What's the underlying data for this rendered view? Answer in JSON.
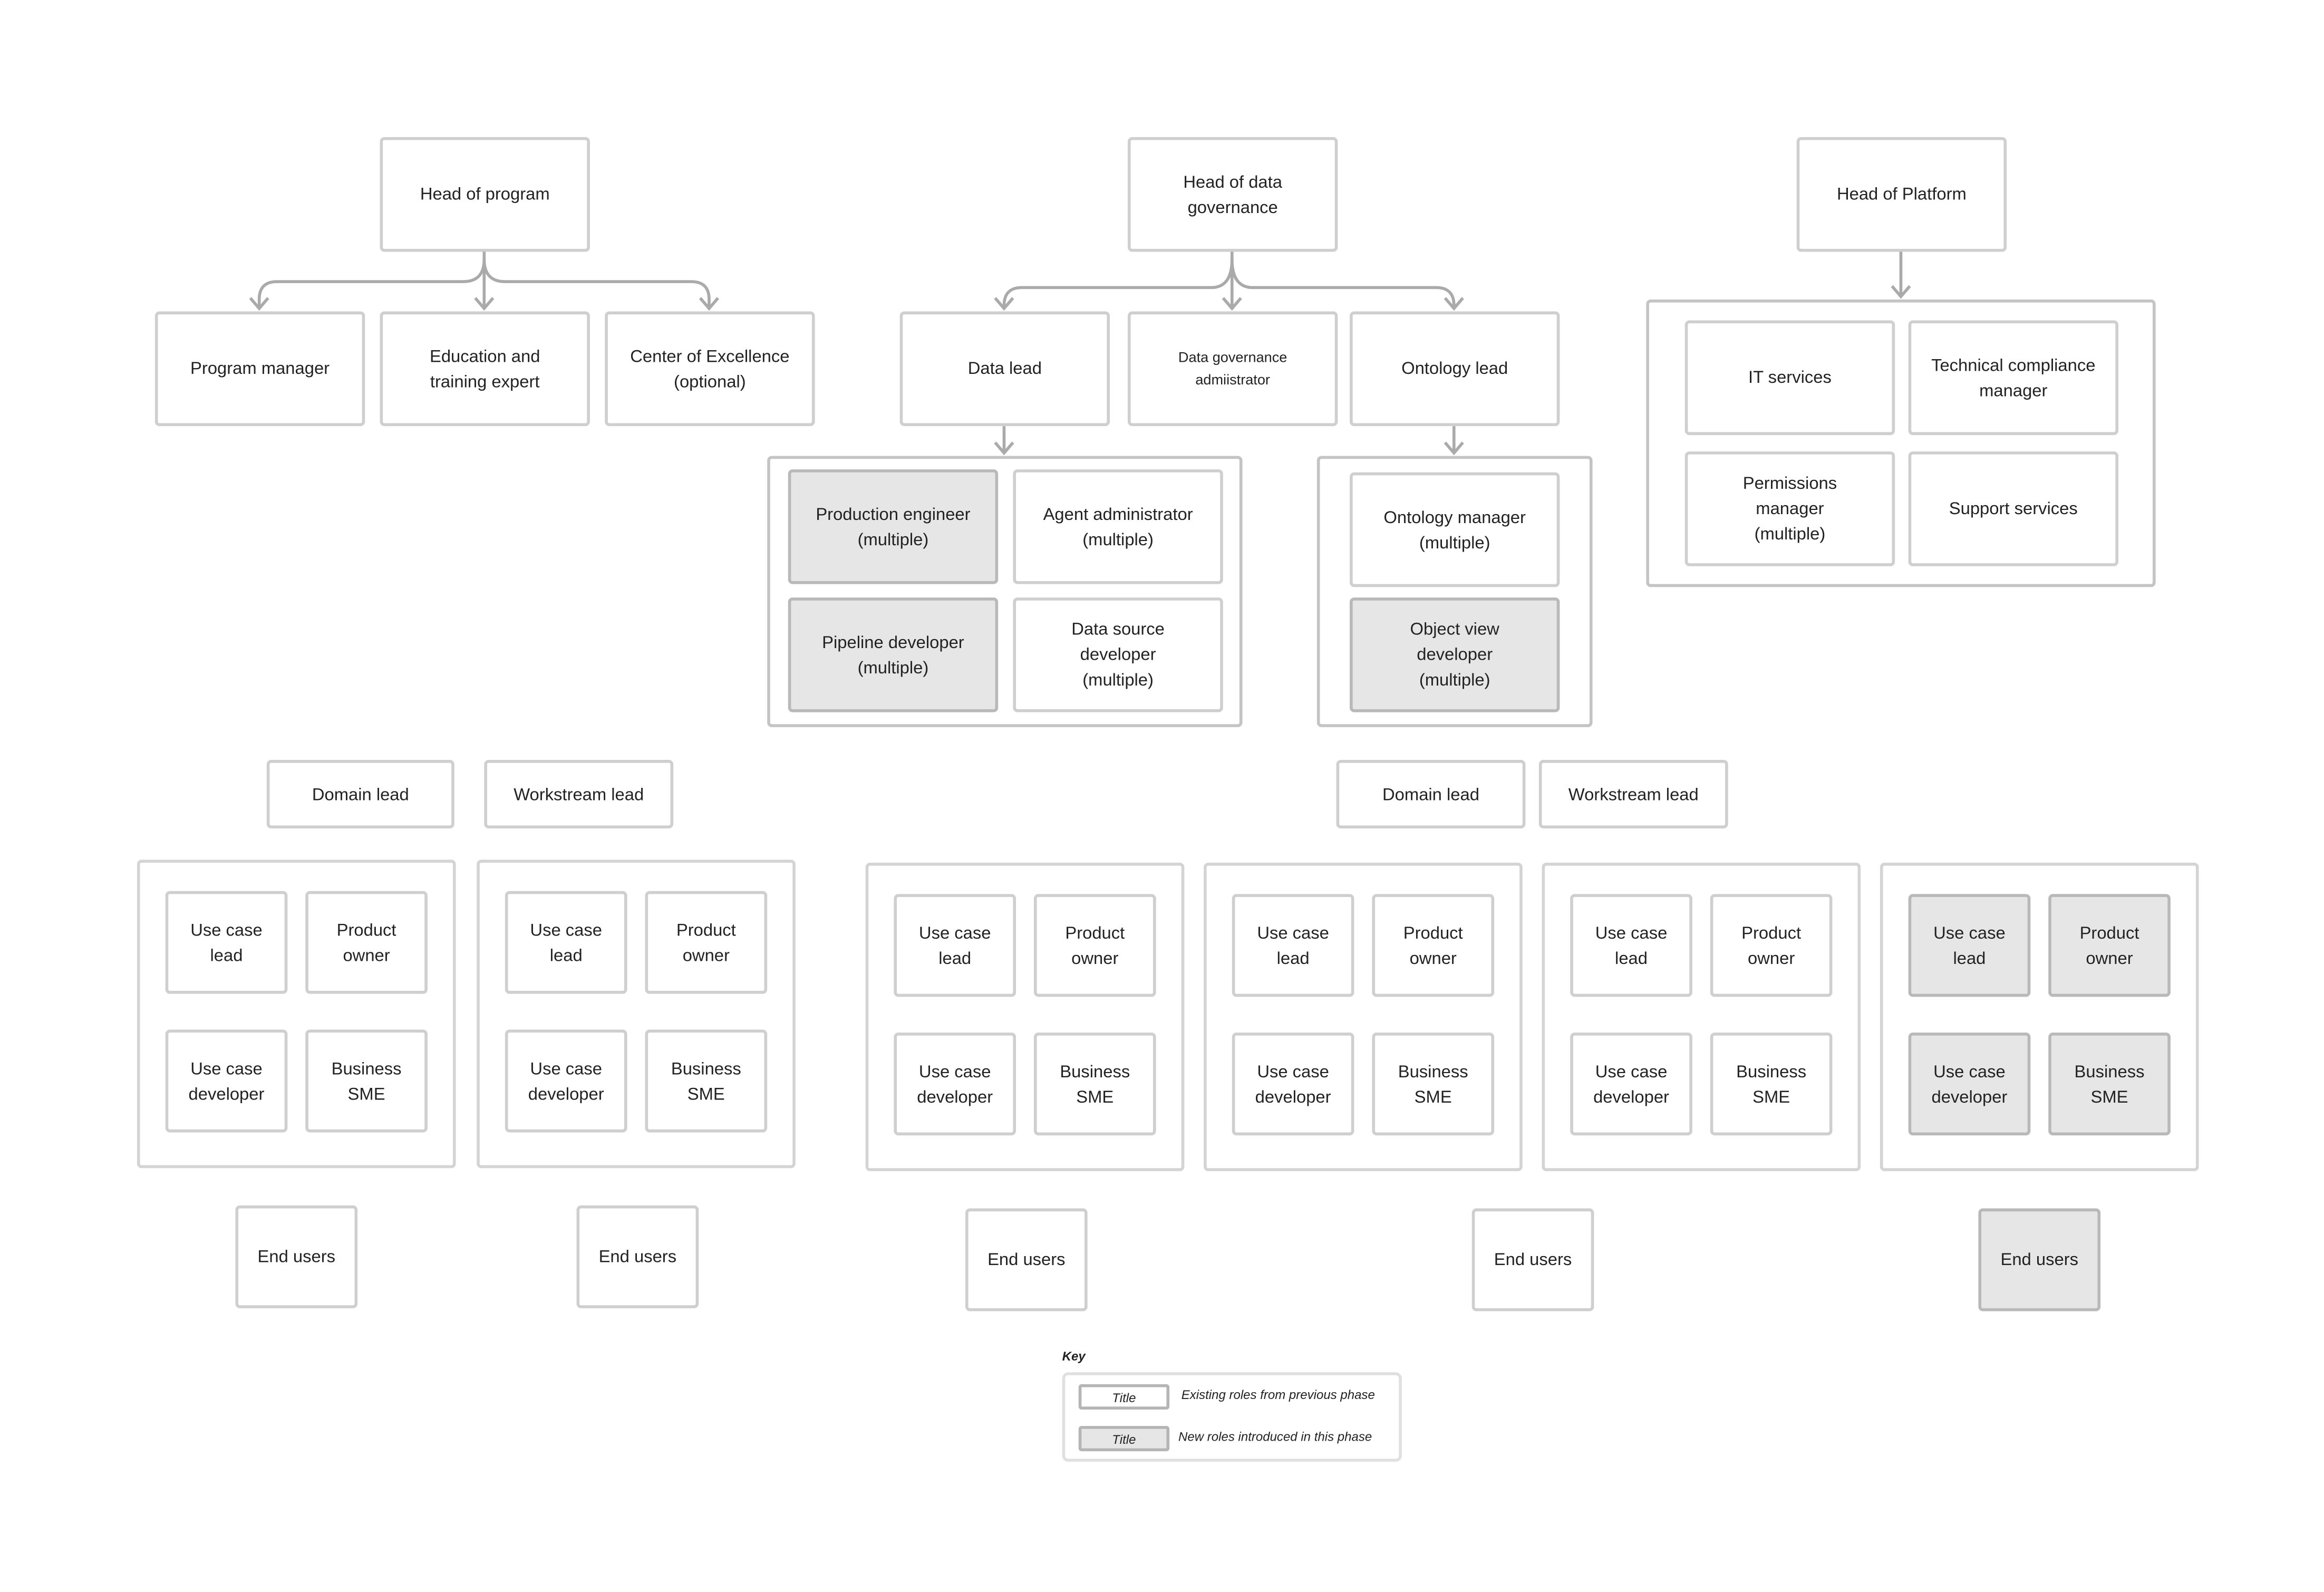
{
  "colors": {
    "existing_fill": "#ffffff",
    "new_fill": "#e6e6e6",
    "border": "#cfcfcf",
    "connector": "#aaaaaa"
  },
  "leadership": {
    "head_of_program": "Head of program",
    "head_of_data_governance": "Head of data\ngovernance",
    "head_of_platform": "Head of Platform"
  },
  "program_team": [
    {
      "label": "Program manager",
      "phase": "existing"
    },
    {
      "label": "Education and\ntraining expert",
      "phase": "existing"
    },
    {
      "label": "Center of Excellence\n(optional)",
      "phase": "existing"
    }
  ],
  "governance_team": [
    {
      "label": "Data lead",
      "phase": "existing"
    },
    {
      "label": "Data governance\nadmiistrator",
      "phase": "existing"
    },
    {
      "label": "Ontology lead",
      "phase": "existing"
    }
  ],
  "data_lead_team": [
    {
      "label": "Production engineer\n(multiple)",
      "phase": "new"
    },
    {
      "label": "Agent administrator\n(multiple)",
      "phase": "existing"
    },
    {
      "label": "Pipeline developer\n(multiple)",
      "phase": "new"
    },
    {
      "label": "Data source\ndeveloper\n(multiple)",
      "phase": "existing"
    }
  ],
  "ontology_team": [
    {
      "label": "Ontology manager\n(multiple)",
      "phase": "existing"
    },
    {
      "label": "Object view\ndeveloper\n(multiple)",
      "phase": "new"
    }
  ],
  "platform_team": [
    {
      "label": "IT services",
      "phase": "existing"
    },
    {
      "label": "Technical compliance\nmanager",
      "phase": "existing"
    },
    {
      "label": "Permissions\nmanager\n(multiple)",
      "phase": "existing"
    },
    {
      "label": "Support services",
      "phase": "existing"
    }
  ],
  "workstream_leads": [
    {
      "label": "Domain lead",
      "phase": "existing"
    },
    {
      "label": "Workstream lead",
      "phase": "existing"
    },
    {
      "label": "Domain lead",
      "phase": "existing"
    },
    {
      "label": "Workstream lead",
      "phase": "existing"
    }
  ],
  "use_case_teams": [
    {
      "phase": "existing",
      "roles": [
        "Use case\nlead",
        "Product\nowner",
        "Use case\ndeveloper",
        "Business\nSME"
      ],
      "end_users": "End users"
    },
    {
      "phase": "existing",
      "roles": [
        "Use case\nlead",
        "Product\nowner",
        "Use case\ndeveloper",
        "Business\nSME"
      ],
      "end_users": "End users"
    },
    {
      "phase": "existing",
      "roles": [
        "Use case\nlead",
        "Product\nowner",
        "Use case\ndeveloper",
        "Business\nSME"
      ],
      "end_users": "End users"
    },
    {
      "phase": "existing",
      "roles": [
        "Use case\nlead",
        "Product\nowner",
        "Use case\ndeveloper",
        "Business\nSME"
      ]
    },
    {
      "phase": "existing",
      "roles": [
        "Use case\nlead",
        "Product\nowner",
        "Use case\ndeveloper",
        "Business\nSME"
      ],
      "end_users": "End users"
    },
    {
      "phase": "new",
      "roles": [
        "Use case\nlead",
        "Product\nowner",
        "Use case\ndeveloper",
        "Business\nSME"
      ],
      "end_users": "End users"
    }
  ],
  "key": {
    "title": "Key",
    "items": [
      {
        "sample": "Title",
        "description": "Existing roles from previous phase",
        "phase": "existing"
      },
      {
        "sample": "Title",
        "description": "New roles introduced in this phase",
        "phase": "new"
      }
    ]
  }
}
